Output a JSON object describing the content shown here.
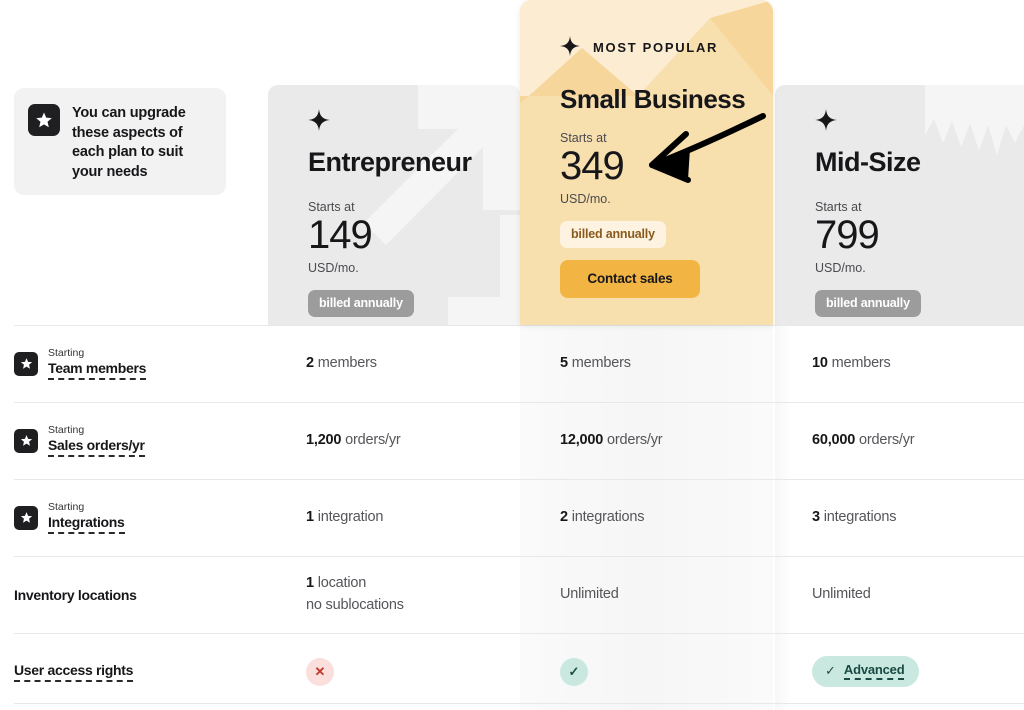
{
  "upgrade_note": {
    "icon": "star-icon",
    "text": "You can upgrade these aspects of each plan to suit your needs"
  },
  "plans": [
    {
      "id": "entrepreneur",
      "sparkle_icon": "sparkle-icon",
      "name": "Entrepreneur",
      "starts_at_label": "Starts at",
      "price": "149",
      "currency": "USD/mo.",
      "billing_badge": "billed annually",
      "featured": false
    },
    {
      "id": "small-business",
      "sparkle_icon": "sparkle-icon",
      "most_popular_label": "MOST POPULAR",
      "name": "Small Business",
      "starts_at_label": "Starts at",
      "price": "349",
      "currency": "USD/mo.",
      "billing_badge": "billed annually",
      "cta_label": "Contact sales",
      "featured": true
    },
    {
      "id": "mid-size",
      "sparkle_icon": "sparkle-icon",
      "name": "Mid-Size",
      "starts_at_label": "Starts at",
      "price": "799",
      "currency": "USD/mo.",
      "billing_badge": "billed annually",
      "featured": false
    }
  ],
  "features": [
    {
      "kicker": "Starting",
      "label": "Team members",
      "upgradable": true,
      "dashed": true,
      "values": [
        {
          "number": "2",
          "unit": "members"
        },
        {
          "number": "5",
          "unit": "members"
        },
        {
          "number": "10",
          "unit": "members"
        }
      ]
    },
    {
      "kicker": "Starting",
      "label": "Sales orders/yr",
      "upgradable": true,
      "dashed": true,
      "values": [
        {
          "number": "1,200",
          "unit": "orders/yr"
        },
        {
          "number": "12,000",
          "unit": "orders/yr"
        },
        {
          "number": "60,000",
          "unit": "orders/yr"
        }
      ]
    },
    {
      "kicker": "Starting",
      "label": "Integrations",
      "upgradable": true,
      "dashed": true,
      "values": [
        {
          "number": "1",
          "unit": "integration"
        },
        {
          "number": "2",
          "unit": "integrations"
        },
        {
          "number": "3",
          "unit": "integrations"
        }
      ]
    },
    {
      "kicker": "",
      "label": "Inventory locations",
      "upgradable": false,
      "dashed": false,
      "values": [
        {
          "number": "1",
          "unit": "location",
          "sub": "no sublocations"
        },
        {
          "number": "",
          "unit": "Unlimited"
        },
        {
          "number": "",
          "unit": "Unlimited"
        }
      ]
    },
    {
      "kicker": "",
      "label": "User access rights",
      "upgradable": false,
      "dashed": true,
      "values": [
        {
          "icon": "cross-icon",
          "icon_type": "no"
        },
        {
          "icon": "check-icon",
          "icon_type": "yes"
        },
        {
          "icon": "check-icon",
          "icon_type": "yes",
          "pill_label": "Advanced"
        }
      ]
    }
  ],
  "annotation": {
    "type": "arrow",
    "points_to": "349"
  },
  "colors": {
    "featured_bg": "#F8DFAE",
    "featured_accent": "#F2B544",
    "card_bg": "#EAEAEA",
    "badge_gray": "#9C9C9C",
    "badge_cream": "#FDF3E0",
    "badge_cream_text": "#8A5A1D",
    "yes_bg": "#C8E8E0",
    "yes_fg": "#1F4F45",
    "no_bg": "#FADFDC",
    "no_fg": "#C0392B",
    "text": "#17171A",
    "muted": "#55555A",
    "divider": "#E8E8E8"
  }
}
